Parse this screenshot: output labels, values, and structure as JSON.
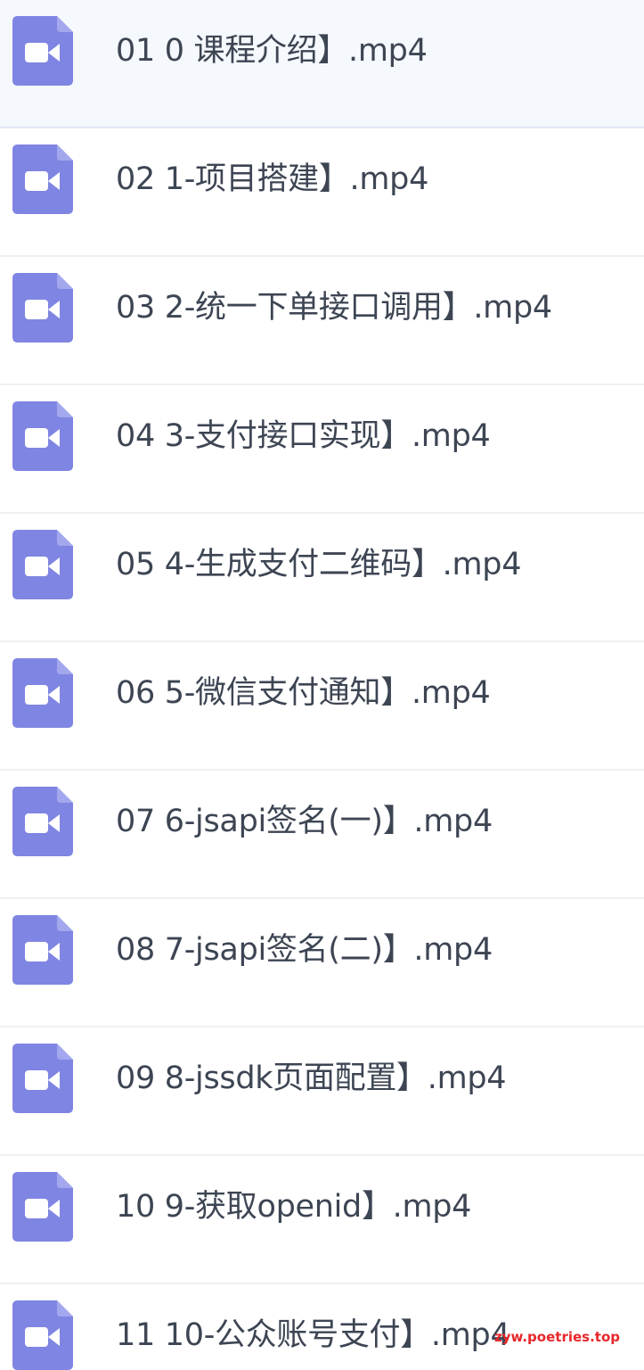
{
  "files": [
    {
      "name": "01 0 课程介绍】.mp4",
      "icon": "video-file-icon",
      "selected": true
    },
    {
      "name": "02 1-项目搭建】.mp4",
      "icon": "video-file-icon"
    },
    {
      "name": "03 2-统一下单接口调用】.mp4",
      "icon": "video-file-icon"
    },
    {
      "name": "04 3-支付接口实现】.mp4",
      "icon": "video-file-icon"
    },
    {
      "name": "05 4-生成支付二维码】.mp4",
      "icon": "video-file-icon"
    },
    {
      "name": "06 5-微信支付通知】.mp4",
      "icon": "video-file-icon"
    },
    {
      "name": "07 6-jsapi签名(一)】.mp4",
      "icon": "video-file-icon"
    },
    {
      "name": "08 7-jsapi签名(二)】.mp4",
      "icon": "video-file-icon"
    },
    {
      "name": "09 8-jssdk页面配置】.mp4",
      "icon": "video-file-icon"
    },
    {
      "name": "10 9-获取openid】.mp4",
      "icon": "video-file-icon"
    },
    {
      "name": "11 10-公众账号支付】.mp4",
      "icon": "video-file-icon"
    }
  ],
  "watermark": "zyw.poetries.top",
  "colors": {
    "icon": "#7f85e2",
    "icon_fold": "#a3a8ee",
    "text": "#3d4553",
    "divider": "#eef0f3",
    "selected_bg": "#f5f8fc",
    "watermark": "#e8262a"
  }
}
